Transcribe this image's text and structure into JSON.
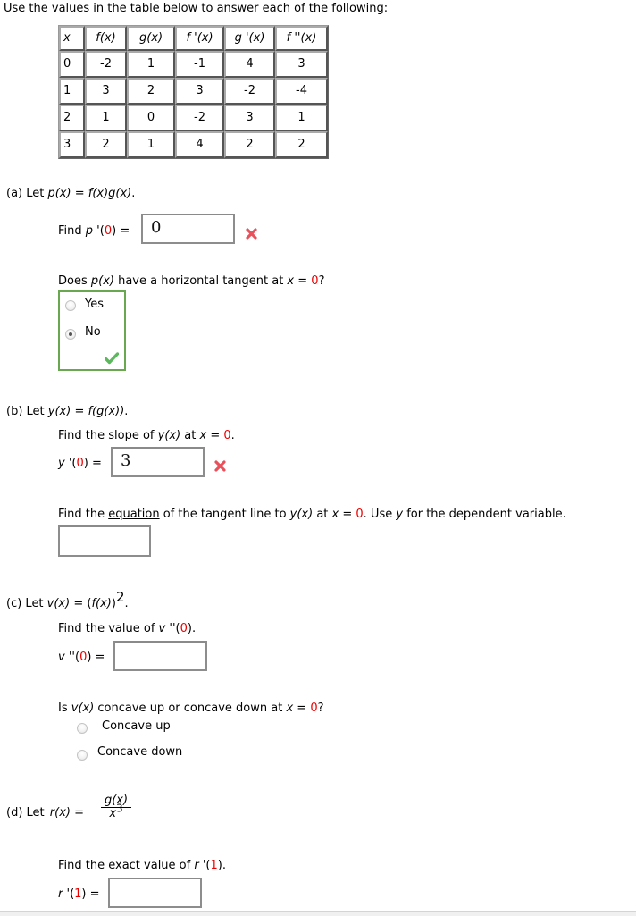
{
  "intro": "Use the values in the table below to answer each of the following:",
  "table": {
    "headers": [
      "x",
      "f(x)",
      "g(x)",
      "f '(x)",
      "g '(x)",
      "f ''(x)"
    ],
    "rows": [
      [
        "0",
        "-2",
        "1",
        "-1",
        "4",
        "3"
      ],
      [
        "1",
        "3",
        "2",
        "3",
        "-2",
        "-4"
      ],
      [
        "2",
        "1",
        "0",
        "-2",
        "3",
        "1"
      ],
      [
        "3",
        "2",
        "1",
        "4",
        "2",
        "2"
      ]
    ]
  },
  "part_a": {
    "label": "(a) Let ",
    "func": "p(x)",
    "eq": " = ",
    "def": "f(x)g(x)",
    "period": ".",
    "find_prefix": "Find ",
    "find_fn": "p",
    "find_paren_open": " '(",
    "find_arg": "0",
    "find_paren_close": ") =",
    "answer_value": "0",
    "answer_status": "incorrect",
    "q2_prefix": "Does ",
    "q2_func": "p(x)",
    "q2_mid": " have a horizontal tangent at ",
    "q2_var": "x",
    "q2_eq": " = ",
    "q2_val": "0",
    "q2_end": "?",
    "options": [
      {
        "label": "Yes",
        "selected": false
      },
      {
        "label": "No",
        "selected": true
      }
    ],
    "q2_status": "correct"
  },
  "part_b": {
    "label": "(b) Let ",
    "func": "y(x)",
    "eq": " = ",
    "def": "f(g(x))",
    "period": ".",
    "slope_prefix": "Find the slope of ",
    "slope_func": "y(x)",
    "slope_mid": " at ",
    "slope_var": "x",
    "slope_eq": " = ",
    "slope_val": "0",
    "slope_end": ".",
    "ans_fn": "y",
    "ans_open": " '(",
    "ans_arg": "0",
    "ans_close": ") =",
    "answer_value": "3",
    "answer_status": "incorrect",
    "eq_prefix": "Find the ",
    "eq_link": "equation",
    "eq_mid": " of the tangent line to ",
    "eq_func": "y(x)",
    "eq_at": " at ",
    "eq_var": "x",
    "eq_equals": " = ",
    "eq_val": "0",
    "eq_use": ". Use ",
    "eq_dep": "y",
    "eq_end": " for the dependent variable.",
    "equation_value": ""
  },
  "part_c": {
    "label": "(c) Let ",
    "func": "v(x)",
    "eq": " = (",
    "inner": "f(x)",
    "close": ")",
    "exp": "2",
    "period": ".",
    "find_prefix": "Find the value of ",
    "find_fn": "v",
    "find_open": " ''(",
    "find_arg": "0",
    "find_close": ").",
    "ans_fn": "v",
    "ans_open": " ''(",
    "ans_arg": "0",
    "ans_close": ") =",
    "answer_value": "",
    "q2_prefix": "Is ",
    "q2_func": "v(x)",
    "q2_mid": " concave up or concave down at ",
    "q2_var": "x",
    "q2_eq": " = ",
    "q2_val": "0",
    "q2_end": "?",
    "options": [
      {
        "label": "Concave up",
        "selected": false
      },
      {
        "label": "Concave down",
        "selected": false
      }
    ]
  },
  "part_d": {
    "label": "(d) Let ",
    "func": "r(x)",
    "eq": " = ",
    "numerator": "g(x)",
    "denominator_base": "x",
    "denominator_exp": "3",
    "find_prefix": "Find the exact value of ",
    "find_fn": "r",
    "find_open": " '(",
    "find_arg": "1",
    "find_close": ").",
    "ans_fn": "r",
    "ans_open": " '(",
    "ans_arg": "1",
    "ans_close": ") =",
    "answer_value": ""
  },
  "colors": {
    "highlight_red": "#ee0000",
    "correct_green": "#6aa84f",
    "incorrect_x": "#e8505b",
    "checkmark": "#5cb85c"
  }
}
